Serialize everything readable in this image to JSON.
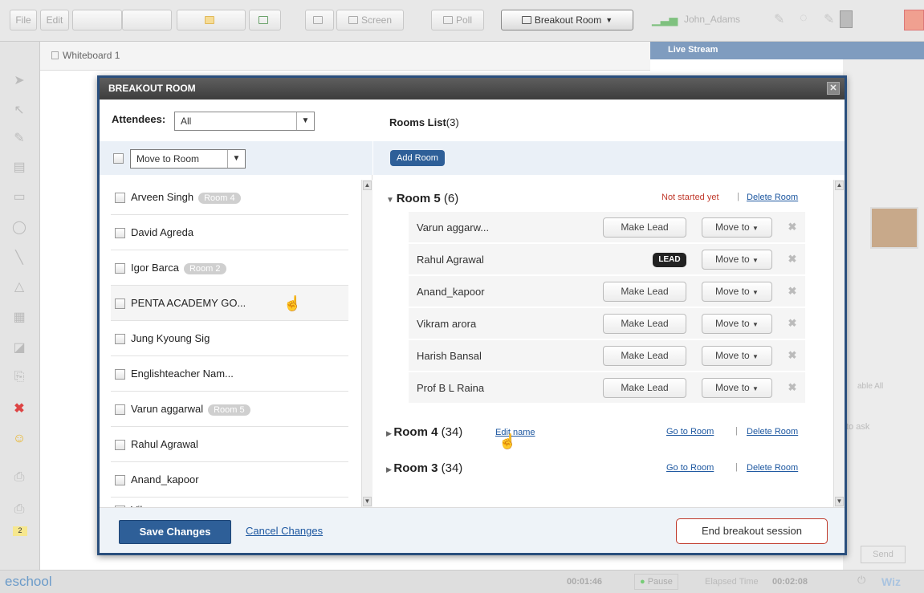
{
  "toolbar": {
    "file": "File",
    "edit": "Edit",
    "screen": "Screen",
    "poll": "Poll",
    "breakout": "Breakout Room",
    "user": "John_Adams"
  },
  "whiteboard": {
    "tab": "Whiteboard 1",
    "live_stream": "Live Stream"
  },
  "dialog": {
    "title": "BREAKOUT ROOM",
    "close": "✕",
    "attendees_label": "Attendees:",
    "attendees_value": "All",
    "move_to_room": "Move to Room",
    "rooms_list_label": "Rooms List",
    "rooms_list_count": "(3)",
    "add_room": "Add Room",
    "attendees": [
      {
        "name": "Arveen Singh",
        "badge": "Room 4"
      },
      {
        "name": "David Agreda",
        "badge": ""
      },
      {
        "name": "Igor Barca",
        "badge": "Room 2"
      },
      {
        "name": "PENTA ACADEMY GO...",
        "badge": ""
      },
      {
        "name": "Jung Kyoung Sig",
        "badge": ""
      },
      {
        "name": "Englishteacher Nam...",
        "badge": ""
      },
      {
        "name": "Varun aggarwal",
        "badge": "Room 5"
      },
      {
        "name": "Rahul Agrawal",
        "badge": ""
      },
      {
        "name": "Anand_kapoor",
        "badge": ""
      },
      {
        "name": "Vikram arora",
        "badge": ""
      }
    ],
    "rooms": [
      {
        "name": "Room 5",
        "count": "(6)",
        "status": "Not started yet",
        "delete": "Delete Room",
        "members": [
          {
            "name": "Varun aggarw...",
            "action": "Make Lead",
            "move": "Move to"
          },
          {
            "name": "Rahul Agrawal",
            "action": "LEAD",
            "move": "Move to"
          },
          {
            "name": "Anand_kapoor",
            "action": "Make Lead",
            "move": "Move to"
          },
          {
            "name": "Vikram arora",
            "action": "Make Lead",
            "move": "Move to"
          },
          {
            "name": "Harish Bansal",
            "action": "Make Lead",
            "move": "Move to"
          },
          {
            "name": "Prof B L Raina",
            "action": "Make Lead",
            "move": "Move to"
          }
        ]
      },
      {
        "name": "Room 4",
        "count": "(34)",
        "edit": "Edit name",
        "goto": "Go to Room",
        "delete": "Delete Room"
      },
      {
        "name": "Room 3",
        "count": "(34)",
        "goto": "Go to Room",
        "delete": "Delete Room"
      }
    ],
    "save": "Save Changes",
    "cancel": "Cancel Changes",
    "end": "End breakout session"
  },
  "status": {
    "logo": "eschool",
    "timer": "00:01:46",
    "pause": "Pause",
    "elapsed_label": "Elapsed Time",
    "elapsed": "00:02:08",
    "brand": "Wiz"
  },
  "side": {
    "enable_all": "able All",
    "ask": "to ask",
    "send": "Send",
    "count": "2"
  },
  "colors": {
    "dialog_border": "#2a4f7d",
    "link": "#1d57a0",
    "status_red": "#c0392b",
    "primary": "#2e5f98"
  }
}
